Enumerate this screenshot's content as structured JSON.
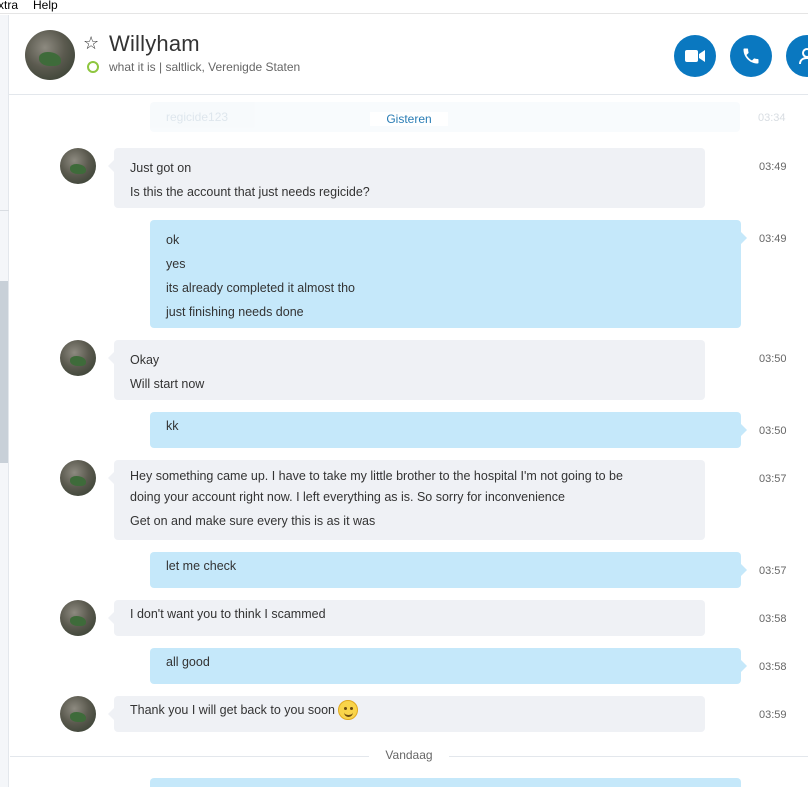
{
  "menu": {
    "items": [
      "xtra",
      "Help"
    ]
  },
  "header": {
    "contact_name": "Willyham",
    "mood": "what it is | saltlick, Verenigde Staten",
    "video_icon": "video-call-icon",
    "call_icon": "phone-call-icon",
    "add_icon": "add-contact-icon"
  },
  "chat": {
    "faded_preview": "regicide123",
    "faded_time": "03:34",
    "day_yesterday": "Gisteren",
    "day_today": "Vandaag",
    "messages": [
      {
        "dir": "in",
        "lines": [
          "Just got on",
          "Is this the account that just needs regicide?"
        ],
        "time": "03:49"
      },
      {
        "dir": "out",
        "lines": [
          "ok",
          "yes",
          "its already completed it almost tho",
          "just finishing needs done"
        ],
        "time": "03:49"
      },
      {
        "dir": "in",
        "lines": [
          "Okay",
          "Will start now"
        ],
        "time": "03:50"
      },
      {
        "dir": "out",
        "lines": [
          "kk"
        ],
        "time": "03:50"
      },
      {
        "dir": "in",
        "lines": [
          "Hey something came up. I have to take my little brother to the hospital I'm not going to be",
          "doing your account right now. I left everything as is. So sorry for inconvenience",
          "Get on and make sure every this is as it was"
        ],
        "time": "03:57"
      },
      {
        "dir": "out",
        "lines": [
          "let me check"
        ],
        "time": "03:57"
      },
      {
        "dir": "in",
        "lines": [
          "I don't want you to think I scammed"
        ],
        "time": "03:58"
      },
      {
        "dir": "out",
        "lines": [
          "all good"
        ],
        "time": "03:58"
      },
      {
        "dir": "in",
        "lines": [
          "Thank you I will get back to you soon"
        ],
        "time": "03:59",
        "emoji": "smile-emoji"
      }
    ]
  },
  "colors": {
    "accent": "#0a78c0",
    "outgoing_bubble": "#c5e8fa",
    "incoming_bubble": "#eff1f5",
    "online_status": "#8ec63f"
  }
}
